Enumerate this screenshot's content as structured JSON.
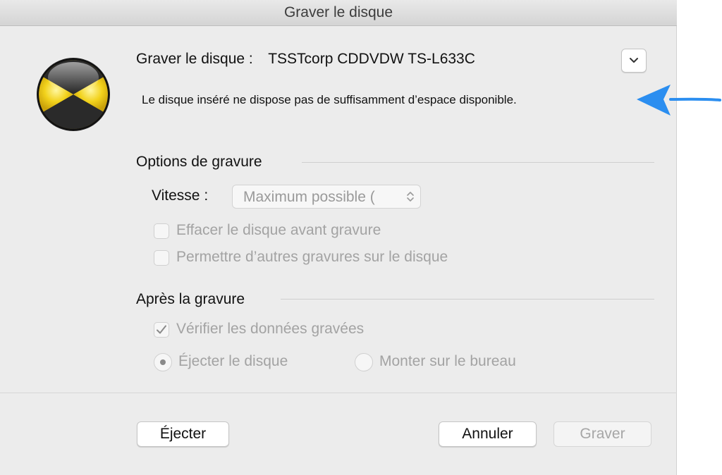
{
  "window": {
    "title": "Graver le disque"
  },
  "icons": {
    "app": "burn-radiation-icon",
    "disclosure": "chevron-down-icon",
    "arrow": "blue-arrow-icon",
    "stepper": "up-down-chevron-icon",
    "check": "checkmark-icon"
  },
  "header": {
    "label": "Graver le disque :",
    "drive": "TSSTcorp CDDVDW TS-L633C"
  },
  "message": "Le disque inséré ne dispose pas de suffisamment d’espace disponible.",
  "burn_options": {
    "title": "Options de gravure",
    "speed_label": "Vitesse :",
    "speed_value": "Maximum possible (",
    "erase_label": "Effacer le disque avant gravure",
    "erase_checked": false,
    "multisession_label": "Permettre d’autres gravures sur le disque",
    "multisession_checked": false
  },
  "after_burn": {
    "title": "Après la gravure",
    "verify_label": "Vérifier les données gravées",
    "verify_checked": true,
    "eject_label": "Éjecter le disque",
    "mount_label": "Monter sur le bureau",
    "selected": "eject"
  },
  "buttons": {
    "eject": "Éjecter",
    "cancel": "Annuler",
    "burn": "Graver"
  },
  "colors": {
    "accent_arrow": "#2b8ef0",
    "icon_yellow": "#f2d21c",
    "icon_dark": "#2a2a2a",
    "disabled_text": "#a3a3a3"
  }
}
